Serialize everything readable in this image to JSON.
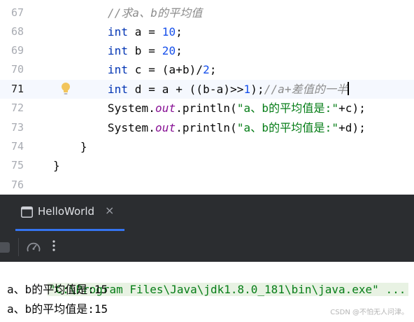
{
  "editor": {
    "lines": [
      {
        "num": "67",
        "text": "        //求a、b的平均值"
      },
      {
        "num": "68",
        "text": "        int a = 10;"
      },
      {
        "num": "69",
        "text": "        int b = 20;"
      },
      {
        "num": "70",
        "text": "        int c = (a+b)/2;"
      },
      {
        "num": "71",
        "text": "        int d = a + ((b-a)>>1);//a+差值的一半",
        "current": true
      },
      {
        "num": "72",
        "text": "        System.out.println(\"a、b的平均值是:\"+c);"
      },
      {
        "num": "73",
        "text": "        System.out.println(\"a、b的平均值是:\"+d);"
      },
      {
        "num": "74",
        "text": "    }"
      },
      {
        "num": "75",
        "text": "}"
      },
      {
        "num": "76",
        "text": ""
      }
    ],
    "intention_icon": "lightbulb-icon",
    "colors": {
      "keyword": "#0033b3",
      "number": "#1750eb",
      "string": "#067d17",
      "comment": "#8c8c8c",
      "static_field": "#871094"
    }
  },
  "run_panel": {
    "tab_label": "HelloWorld",
    "tab_icon": "console-icon",
    "close_glyph": "×",
    "toolbar_icons": [
      "stop-icon",
      "profiler-icon",
      "more-options-icon"
    ],
    "console_lines": [
      "\"C:\\Program Files\\Java\\jdk1.8.0_181\\bin\\java.exe\" ...",
      "a、b的平均值是:15",
      "a、b的平均值是:15"
    ]
  },
  "watermark": "CSDN @不怕无人问津。"
}
